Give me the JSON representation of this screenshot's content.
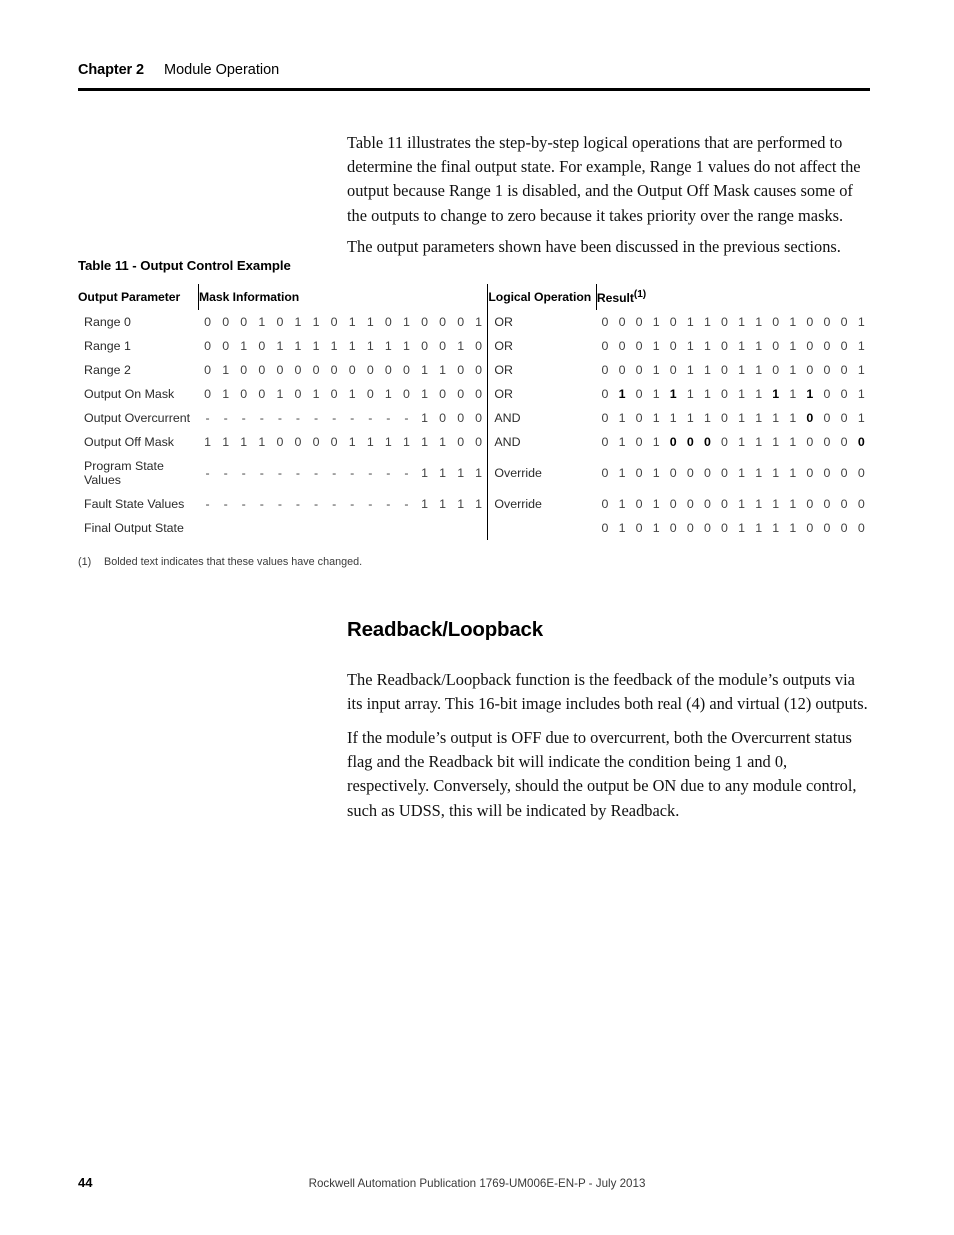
{
  "header": {
    "chapter": "Chapter 2",
    "section": "Module Operation"
  },
  "body": {
    "para_intro": "Table 11 illustrates the step-by-step logical operations that are performed to determine the final output state. For example, Range 1 values do not affect the output because Range 1 is disabled, and the Output Off Mask causes some of the outputs to change to zero because it takes priority over the range masks.",
    "para_params": "The output parameters shown have been discussed in the previous sections."
  },
  "table": {
    "caption": "Table 11 - Output Control Example",
    "headers": {
      "output_parameter": "Output Parameter",
      "mask_information": "Mask Information",
      "logical_operation": "Logical Operation",
      "result": "Result",
      "result_footnote_marker": "(1)"
    },
    "footnote": {
      "marker": "(1)",
      "text": "Bolded text indicates that these values have changed."
    },
    "rows": [
      {
        "parameter": "Range 0",
        "mask": [
          "0",
          "0",
          "0",
          "1",
          "0",
          "1",
          "1",
          "0",
          "1",
          "1",
          "0",
          "1",
          "0",
          "0",
          "0",
          "1"
        ],
        "operation": "OR",
        "result": [
          "0",
          "0",
          "0",
          "1",
          "0",
          "1",
          "1",
          "0",
          "1",
          "1",
          "0",
          "1",
          "0",
          "0",
          "0",
          "1"
        ],
        "result_bold": [
          false,
          false,
          false,
          false,
          false,
          false,
          false,
          false,
          false,
          false,
          false,
          false,
          false,
          false,
          false,
          false
        ]
      },
      {
        "parameter": "Range 1",
        "mask": [
          "0",
          "0",
          "1",
          "0",
          "1",
          "1",
          "1",
          "1",
          "1",
          "1",
          "1",
          "1",
          "0",
          "0",
          "1",
          "0"
        ],
        "operation": "OR",
        "result": [
          "0",
          "0",
          "0",
          "1",
          "0",
          "1",
          "1",
          "0",
          "1",
          "1",
          "0",
          "1",
          "0",
          "0",
          "0",
          "1"
        ],
        "result_bold": [
          false,
          false,
          false,
          false,
          false,
          false,
          false,
          false,
          false,
          false,
          false,
          false,
          false,
          false,
          false,
          false
        ]
      },
      {
        "parameter": "Range 2",
        "mask": [
          "0",
          "1",
          "0",
          "0",
          "0",
          "0",
          "0",
          "0",
          "0",
          "0",
          "0",
          "0",
          "1",
          "1",
          "0",
          "0"
        ],
        "operation": "OR",
        "result": [
          "0",
          "0",
          "0",
          "1",
          "0",
          "1",
          "1",
          "0",
          "1",
          "1",
          "0",
          "1",
          "0",
          "0",
          "0",
          "1"
        ],
        "result_bold": [
          false,
          false,
          false,
          false,
          false,
          false,
          false,
          false,
          false,
          false,
          false,
          false,
          false,
          false,
          false,
          false
        ]
      },
      {
        "parameter": "Output On Mask",
        "mask": [
          "0",
          "1",
          "0",
          "0",
          "1",
          "0",
          "1",
          "0",
          "1",
          "0",
          "1",
          "0",
          "1",
          "0",
          "0",
          "0"
        ],
        "operation": "OR",
        "result": [
          "0",
          "1",
          "0",
          "1",
          "1",
          "1",
          "1",
          "0",
          "1",
          "1",
          "1",
          "1",
          "1",
          "0",
          "0",
          "1"
        ],
        "result_bold": [
          false,
          true,
          false,
          false,
          true,
          false,
          false,
          false,
          false,
          false,
          true,
          false,
          true,
          false,
          false,
          false
        ]
      },
      {
        "parameter": "Output Overcurrent",
        "mask": [
          "-",
          "-",
          "-",
          "-",
          "-",
          "-",
          "-",
          "-",
          "-",
          "-",
          "-",
          "-",
          "1",
          "0",
          "0",
          "0"
        ],
        "operation": "AND",
        "result": [
          "0",
          "1",
          "0",
          "1",
          "1",
          "1",
          "1",
          "0",
          "1",
          "1",
          "1",
          "1",
          "0",
          "0",
          "0",
          "1"
        ],
        "result_bold": [
          false,
          false,
          false,
          false,
          false,
          false,
          false,
          false,
          false,
          false,
          false,
          false,
          true,
          false,
          false,
          false
        ]
      },
      {
        "parameter": "Output Off Mask",
        "mask": [
          "1",
          "1",
          "1",
          "1",
          "0",
          "0",
          "0",
          "0",
          "1",
          "1",
          "1",
          "1",
          "1",
          "1",
          "0",
          "0"
        ],
        "operation": "AND",
        "result": [
          "0",
          "1",
          "0",
          "1",
          "0",
          "0",
          "0",
          "0",
          "1",
          "1",
          "1",
          "1",
          "0",
          "0",
          "0",
          "0"
        ],
        "result_bold": [
          false,
          false,
          false,
          false,
          true,
          true,
          true,
          false,
          false,
          false,
          false,
          false,
          false,
          false,
          false,
          true
        ]
      },
      {
        "parameter": "Program State Values",
        "mask": [
          "-",
          "-",
          "-",
          "-",
          "-",
          "-",
          "-",
          "-",
          "-",
          "-",
          "-",
          "-",
          "1",
          "1",
          "1",
          "1"
        ],
        "operation": "Override",
        "result": [
          "0",
          "1",
          "0",
          "1",
          "0",
          "0",
          "0",
          "0",
          "1",
          "1",
          "1",
          "1",
          "0",
          "0",
          "0",
          "0"
        ],
        "result_bold": [
          false,
          false,
          false,
          false,
          false,
          false,
          false,
          false,
          false,
          false,
          false,
          false,
          false,
          false,
          false,
          false
        ]
      },
      {
        "parameter": "Fault State Values",
        "mask": [
          "-",
          "-",
          "-",
          "-",
          "-",
          "-",
          "-",
          "-",
          "-",
          "-",
          "-",
          "-",
          "1",
          "1",
          "1",
          "1"
        ],
        "operation": "Override",
        "result": [
          "0",
          "1",
          "0",
          "1",
          "0",
          "0",
          "0",
          "0",
          "1",
          "1",
          "1",
          "1",
          "0",
          "0",
          "0",
          "0"
        ],
        "result_bold": [
          false,
          false,
          false,
          false,
          false,
          false,
          false,
          false,
          false,
          false,
          false,
          false,
          false,
          false,
          false,
          false
        ]
      },
      {
        "parameter": "Final Output State",
        "mask": [
          "",
          "",
          "",
          "",
          "",
          "",
          "",
          "",
          "",
          "",
          "",
          "",
          "",
          "",
          "",
          ""
        ],
        "operation": "",
        "result": [
          "0",
          "1",
          "0",
          "1",
          "0",
          "0",
          "0",
          "0",
          "1",
          "1",
          "1",
          "1",
          "0",
          "0",
          "0",
          "0"
        ],
        "result_bold": [
          false,
          false,
          false,
          false,
          false,
          false,
          false,
          false,
          false,
          false,
          false,
          false,
          false,
          false,
          false,
          false
        ]
      }
    ]
  },
  "section": {
    "heading": "Readback/Loopback",
    "para_1": "The Readback/Loopback function is the feedback of the module’s outputs via its input array. This 16-bit image includes both real (4) and virtual (12) outputs.",
    "para_2": "If the module’s output is OFF due to overcurrent, both the Overcurrent status flag and the Readback bit will indicate the condition being 1 and 0, respectively. Conversely, should the output be ON due to any module control, such as UDSS, this will be indicated by Readback."
  },
  "footer": {
    "page_number": "44",
    "publication": "Rockwell Automation Publication 1769-UM006E-EN-P - July 2013"
  }
}
